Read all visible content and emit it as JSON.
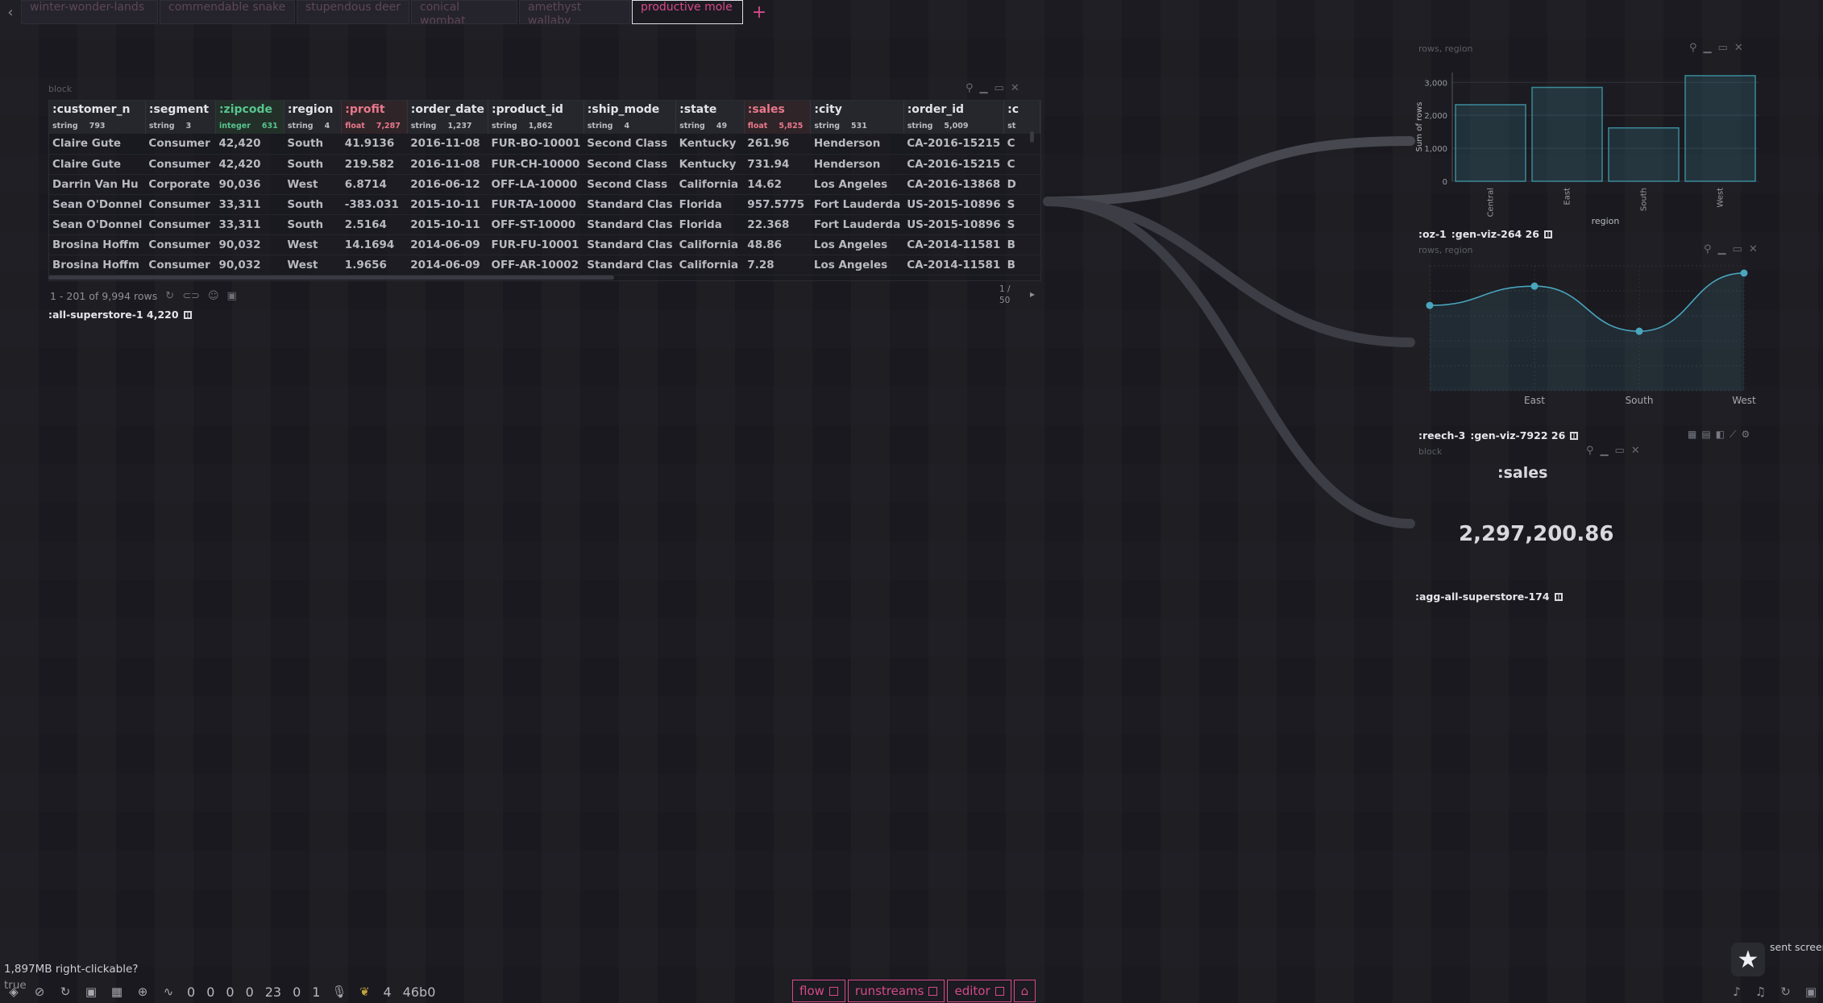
{
  "tabs": {
    "back_label": "‹",
    "items": [
      {
        "label": "winter-wonder-lands"
      },
      {
        "label": "commendable snake"
      },
      {
        "label": "stupendous deer"
      },
      {
        "label": "conical wombat"
      },
      {
        "label": "amethyst wallaby"
      },
      {
        "label": "productive mole"
      }
    ],
    "add_label": "+"
  },
  "grid_block": {
    "block_label": "block",
    "columns": [
      {
        "name": ":customer_n",
        "type": "string",
        "count": "793"
      },
      {
        "name": ":segment",
        "type": "string",
        "count": "3"
      },
      {
        "name": ":zipcode",
        "type": "integer",
        "count": "631"
      },
      {
        "name": ":region",
        "type": "string",
        "count": "4"
      },
      {
        "name": ":profit",
        "type": "float",
        "count": "7,287"
      },
      {
        "name": ":order_date",
        "type": "string",
        "count": "1,237"
      },
      {
        "name": ":product_id",
        "type": "string",
        "count": "1,862"
      },
      {
        "name": ":ship_mode",
        "type": "string",
        "count": "4"
      },
      {
        "name": ":state",
        "type": "string",
        "count": "49"
      },
      {
        "name": ":sales",
        "type": "float",
        "count": "5,825"
      },
      {
        "name": ":city",
        "type": "string",
        "count": "531"
      },
      {
        "name": ":order_id",
        "type": "string",
        "count": "5,009"
      },
      {
        "name": ":c",
        "type": "st",
        "count": ""
      }
    ],
    "rows": [
      [
        "Claire Gute",
        "Consumer",
        "42,420",
        "South",
        "41.9136",
        "2016-11-08",
        "FUR-BO-10001",
        "Second Class",
        "Kentucky",
        "261.96",
        "Henderson",
        "CA-2016-15215",
        "C"
      ],
      [
        "Claire Gute",
        "Consumer",
        "42,420",
        "South",
        "219.582",
        "2016-11-08",
        "FUR-CH-10000",
        "Second Class",
        "Kentucky",
        "731.94",
        "Henderson",
        "CA-2016-15215",
        "C"
      ],
      [
        "Darrin Van Hu",
        "Corporate",
        "90,036",
        "West",
        "6.8714",
        "2016-06-12",
        "OFF-LA-10000",
        "Second Class",
        "California",
        "14.62",
        "Los Angeles",
        "CA-2016-13868",
        "D"
      ],
      [
        "Sean O'Donnel",
        "Consumer",
        "33,311",
        "South",
        "-383.031",
        "2015-10-11",
        "FUR-TA-10000",
        "Standard Clas",
        "Florida",
        "957.5775",
        "Fort Lauderda",
        "US-2015-10896",
        "S"
      ],
      [
        "Sean O'Donnel",
        "Consumer",
        "33,311",
        "South",
        "2.5164",
        "2015-10-11",
        "OFF-ST-10000",
        "Standard Clas",
        "Florida",
        "22.368",
        "Fort Lauderda",
        "US-2015-10896",
        "S"
      ],
      [
        "Brosina Hoffm",
        "Consumer",
        "90,032",
        "West",
        "14.1694",
        "2014-06-09",
        "FUR-FU-10001",
        "Standard Clas",
        "California",
        "48.86",
        "Los Angeles",
        "CA-2014-11581",
        "B"
      ],
      [
        "Brosina Hoffm",
        "Consumer",
        "90,032",
        "West",
        "1.9656",
        "2014-06-09",
        "OFF-AR-10002",
        "Standard Clas",
        "California",
        "7.28",
        "Los Angeles",
        "CA-2014-11581",
        "B"
      ]
    ],
    "footer_text": "1 - 201 of 9,994 rows",
    "pager_text": "1 / 50",
    "node_name": ":all-superstore-1 4,220"
  },
  "bar_panel": {
    "caption": "rows, region",
    "node_name_a": ":oz-1",
    "node_name_b": ":gen-viz-264 26"
  },
  "line_panel": {
    "caption": "rows, region",
    "node_name_a": ":reech-3",
    "node_name_b": ":gen-viz-7922 26"
  },
  "agg_panel": {
    "caption": "block",
    "label": ":sales",
    "value": "2,297,200.86",
    "node_name": ":agg-all-superstore-174"
  },
  "chart_data": [
    {
      "type": "bar",
      "categories": [
        "Central",
        "East",
        "South",
        "West"
      ],
      "values": [
        2323,
        2848,
        1620,
        3203
      ],
      "xlabel": "region",
      "ylabel": "Sum of rows",
      "ylim": [
        0,
        3300
      ],
      "yticks": [
        "0",
        "1,000",
        "2,000",
        "3,000"
      ],
      "bar_color": "#3b8a9a"
    },
    {
      "type": "area",
      "categories": [
        "Central",
        "East",
        "South",
        "West"
      ],
      "tick_labels": [
        "",
        "East",
        "South",
        "West"
      ],
      "values": [
        2323,
        2848,
        1620,
        3203
      ],
      "ylim": [
        0,
        3400
      ],
      "line_color": "#49a6bd"
    }
  ],
  "status": {
    "memory_note": "1,897MB right-clickable?",
    "true_note": "true",
    "numbers": [
      "0",
      "0",
      "0",
      "0",
      "23",
      "0",
      "1"
    ],
    "leaf_count": "4",
    "hash": "46b0"
  },
  "bottom_tabs": [
    {
      "label": "flow"
    },
    {
      "label": "runstreams"
    },
    {
      "label": "editor"
    }
  ],
  "sent_note": "sent screen"
}
